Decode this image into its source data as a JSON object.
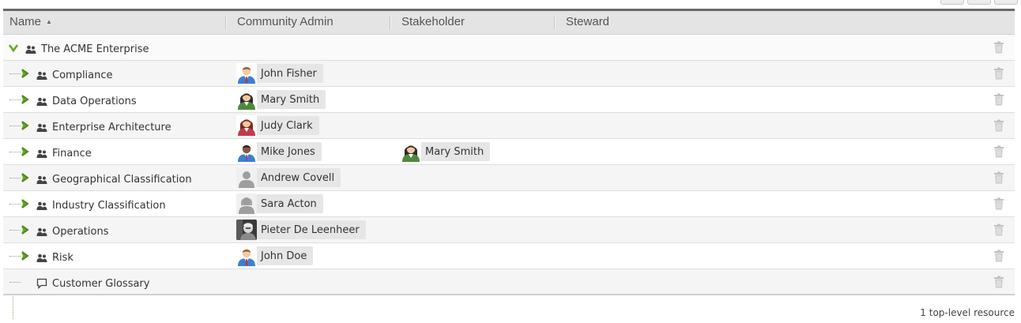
{
  "columns": {
    "name": "Name",
    "community_admin": "Community Admin",
    "stakeholder": "Stakeholder",
    "steward": "Steward"
  },
  "rows": [
    {
      "name": "The ACME Enterprise",
      "type": "community",
      "expanded": true,
      "admin": null,
      "stakeholder": null
    },
    {
      "name": "Compliance",
      "type": "community",
      "admin": {
        "name": "John Fisher",
        "avatar": "man-blue"
      },
      "stakeholder": null
    },
    {
      "name": "Data Operations",
      "type": "community",
      "admin": {
        "name": "Mary Smith",
        "avatar": "woman-green"
      },
      "stakeholder": null
    },
    {
      "name": "Enterprise Architecture",
      "type": "community",
      "admin": {
        "name": "Judy Clark",
        "avatar": "woman-red"
      },
      "stakeholder": null
    },
    {
      "name": "Finance",
      "type": "community",
      "admin": {
        "name": "Mike Jones",
        "avatar": "man-dark"
      },
      "stakeholder": {
        "name": "Mary Smith",
        "avatar": "woman-green"
      }
    },
    {
      "name": "Geographical Classification",
      "type": "community",
      "admin": {
        "name": "Andrew Covell",
        "avatar": "silhouette-man"
      },
      "stakeholder": null
    },
    {
      "name": "Industry Classification",
      "type": "community",
      "admin": {
        "name": "Sara Acton",
        "avatar": "silhouette-woman"
      },
      "stakeholder": null
    },
    {
      "name": "Operations",
      "type": "community",
      "admin": {
        "name": "Pieter De Leenheer",
        "avatar": "photo"
      },
      "stakeholder": null
    },
    {
      "name": "Risk",
      "type": "community",
      "admin": {
        "name": "John Doe",
        "avatar": "man-blue"
      },
      "stakeholder": null
    },
    {
      "name": "Customer Glossary",
      "type": "glossary",
      "admin": null,
      "stakeholder": null
    }
  ],
  "footer": {
    "summary": "1 top-level resource"
  },
  "colors": {
    "accent_green": "#6aa52a",
    "header_bg": "#e4e4e4"
  }
}
